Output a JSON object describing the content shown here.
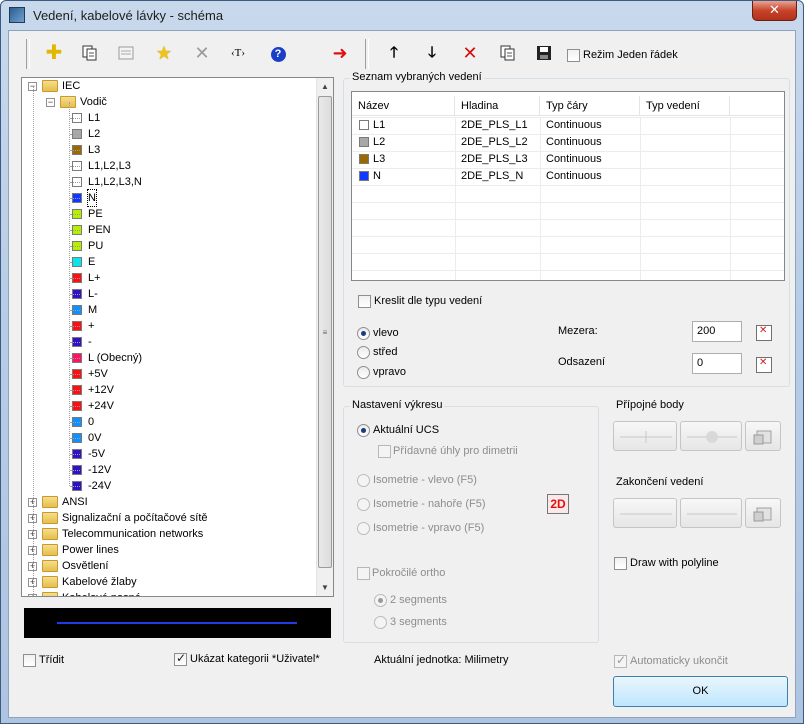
{
  "window": {
    "title": "Vedení, kabelové lávky - schéma",
    "close_glyph": "✕"
  },
  "toolbar": {
    "left_icons": [
      "add-icon",
      "copy-icon",
      "properties-icon",
      "favorite-star-icon",
      "delete-icon",
      "text-tag-icon",
      "help-icon"
    ],
    "text_tag_label": "‹T›",
    "help_label": "?",
    "right_icons": [
      "insert-arrow-icon",
      "move-up-icon",
      "move-down-icon",
      "remove-icon",
      "copy-icon",
      "save-icon"
    ],
    "single_row_label": "Režim Jeden řádek",
    "single_row_checked": false
  },
  "tree": {
    "root": "IEC",
    "subfolder": "Vodič",
    "conductors": [
      {
        "label": "L1",
        "color": "#ffffff"
      },
      {
        "label": "L2",
        "color": "#a8a8a8"
      },
      {
        "label": "L3",
        "color": "#9a6a00"
      },
      {
        "label": "L1,L2,L3",
        "color": "#ffffff"
      },
      {
        "label": "L1,L2,L3,N",
        "color": "#ffffff"
      },
      {
        "label": "N",
        "color": "#1038ff"
      },
      {
        "label": "PE",
        "color": "#b4f000"
      },
      {
        "label": "PEN",
        "color": "#b4f000"
      },
      {
        "label": "PU",
        "color": "#b4f000"
      },
      {
        "label": "E",
        "color": "#00e8f0"
      },
      {
        "label": "L+",
        "color": "#ff1010"
      },
      {
        "label": "L-",
        "color": "#3010c8"
      },
      {
        "label": "M",
        "color": "#1090ff"
      },
      {
        "label": "+",
        "color": "#ff1010"
      },
      {
        "label": "-",
        "color": "#3010c8"
      },
      {
        "label": "L (Obecný)",
        "color": "#ff1060"
      },
      {
        "label": "+5V",
        "color": "#ff1010"
      },
      {
        "label": "+12V",
        "color": "#ff1010"
      },
      {
        "label": "+24V",
        "color": "#ff1010"
      },
      {
        "label": "0",
        "color": "#1090ff"
      },
      {
        "label": "0V",
        "color": "#1090ff"
      },
      {
        "label": "-5V",
        "color": "#3010c8"
      },
      {
        "label": "-12V",
        "color": "#3010c8"
      },
      {
        "label": "-24V",
        "color": "#3010c8"
      }
    ],
    "selected": "N",
    "other_folders": [
      "ANSI",
      "Signalizační a počítačové sítě",
      "Telecommunication networks",
      "Power lines",
      "Osvětlení",
      "Kabelové žlaby",
      "Kabelové nosné"
    ]
  },
  "preview_line_color": "#2338e6",
  "selected_lines": {
    "title": "Seznam vybraných vedení",
    "columns": [
      "Název",
      "Hladina",
      "Typ čáry",
      "Typ vedení"
    ],
    "rows": [
      {
        "name": "L1",
        "color": "#ffffff",
        "layer": "2DE_PLS_L1",
        "linetype": "Continuous",
        "kind": ""
      },
      {
        "name": "L2",
        "color": "#a8a8a8",
        "layer": "2DE_PLS_L2",
        "linetype": "Continuous",
        "kind": ""
      },
      {
        "name": "L3",
        "color": "#9a6a00",
        "layer": "2DE_PLS_L3",
        "linetype": "Continuous",
        "kind": ""
      },
      {
        "name": "N",
        "color": "#1038ff",
        "layer": "2DE_PLS_N",
        "linetype": "Continuous",
        "kind": ""
      }
    ],
    "draw_by_type_label": "Kreslit dle typu vedení",
    "draw_by_type_checked": false,
    "side_options": [
      "vlevo",
      "střed",
      "vpravo"
    ],
    "side_selected": "vlevo",
    "spacing_label": "Mezera:",
    "spacing_value": "200",
    "offset_label": "Odsazení",
    "offset_value": "0"
  },
  "drawing_settings": {
    "title": "Nastavení výkresu",
    "current_ucs_label": "Aktuální UCS",
    "current_ucs_selected": true,
    "extra_angles_label": "Přídavné úhly pro dimetrii",
    "iso_options": [
      "Isometrie - vlevo (F5)",
      "Isometrie - nahoře (F5)",
      "Isometrie - vpravo (F5)"
    ],
    "mode_badge": "2D",
    "advanced_ortho_label": "Pokročilé ortho",
    "segment_options": [
      "2 segments",
      "3 segments"
    ],
    "segment_selected": "2 segments"
  },
  "connection_points": {
    "title": "Přípojné body"
  },
  "line_endings": {
    "title": "Zakončení vedení"
  },
  "draw_polyline_label": "Draw with polyline",
  "draw_polyline_checked": false,
  "footer": {
    "sort_label": "Třídit",
    "sort_checked": false,
    "show_category_label": "Ukázat kategorii *Uživatel*",
    "show_category_checked": true,
    "current_unit": "Aktuální jednotka: Milimetry",
    "auto_finish_label": "Automaticky ukončit",
    "auto_finish_checked": true,
    "ok_label": "OK"
  }
}
